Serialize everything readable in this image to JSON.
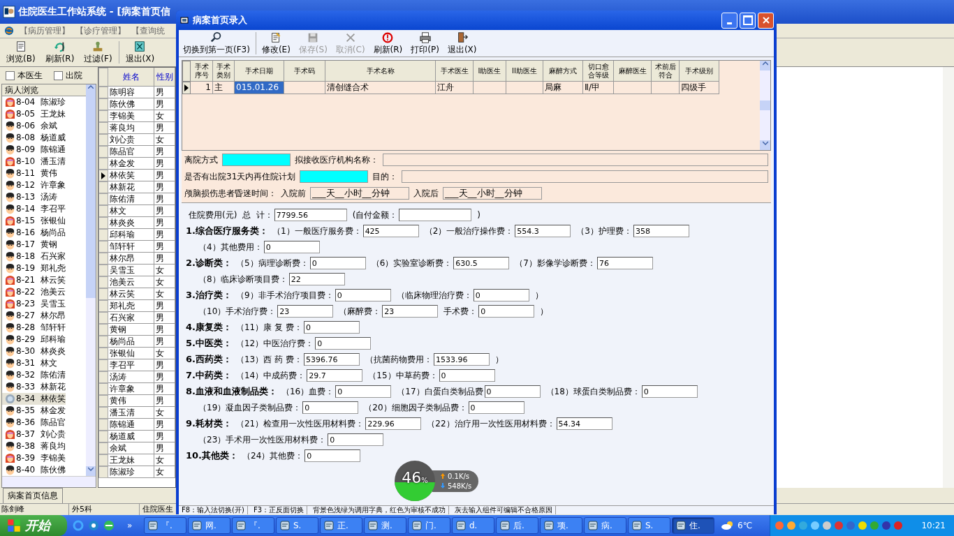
{
  "main_window": {
    "title": "住院医生工作站系统 - [病案首页信",
    "menu": [
      "【病历管理】",
      "【诊疗管理】",
      "【查询统"
    ],
    "toolbar": [
      {
        "label": "浏览(B)"
      },
      {
        "label": "刷新(R)"
      },
      {
        "label": "过滤(F)"
      },
      {
        "label": "退出(X)"
      }
    ],
    "filters": [
      {
        "label": "本医生",
        "checked": false
      },
      {
        "label": "出院",
        "checked": false
      }
    ],
    "patient_list": {
      "header": "病人浏览",
      "items": [
        {
          "bed": "8-04",
          "name": "陈淑珍",
          "female": true,
          "selected": false
        },
        {
          "bed": "8-05",
          "name": "王龙妹",
          "female": true,
          "selected": false
        },
        {
          "bed": "8-06",
          "name": "余斌",
          "female": false,
          "selected": false
        },
        {
          "bed": "8-08",
          "name": "杨道威",
          "female": false,
          "selected": false
        },
        {
          "bed": "8-09",
          "name": "陈锦通",
          "female": false,
          "selected": false
        },
        {
          "bed": "8-10",
          "name": "潘玉清",
          "female": true,
          "selected": false
        },
        {
          "bed": "8-11",
          "name": "黄伟",
          "female": false,
          "selected": false
        },
        {
          "bed": "8-12",
          "name": "许章象",
          "female": false,
          "selected": false
        },
        {
          "bed": "8-13",
          "name": "汤涛",
          "female": false,
          "selected": false
        },
        {
          "bed": "8-14",
          "name": "李召平",
          "female": false,
          "selected": false
        },
        {
          "bed": "8-15",
          "name": "张银仙",
          "female": true,
          "selected": false
        },
        {
          "bed": "8-16",
          "name": "杨尚品",
          "female": false,
          "selected": false
        },
        {
          "bed": "8-17",
          "name": "黄钢",
          "female": false,
          "selected": false
        },
        {
          "bed": "8-18",
          "name": "石兴家",
          "female": false,
          "selected": false
        },
        {
          "bed": "8-19",
          "name": "郑礼尧",
          "female": false,
          "selected": false
        },
        {
          "bed": "8-21",
          "name": "林云笑",
          "female": true,
          "selected": false
        },
        {
          "bed": "8-22",
          "name": "池美云",
          "female": true,
          "selected": false
        },
        {
          "bed": "8-23",
          "name": "吴雪玉",
          "female": true,
          "selected": false
        },
        {
          "bed": "8-27",
          "name": "林尔昂",
          "female": false,
          "selected": false
        },
        {
          "bed": "8-28",
          "name": "邹轩轩",
          "female": false,
          "selected": false
        },
        {
          "bed": "8-29",
          "name": "邱科瑜",
          "female": false,
          "selected": false
        },
        {
          "bed": "8-30",
          "name": "林炎炎",
          "female": false,
          "selected": false
        },
        {
          "bed": "8-31",
          "name": "林文",
          "female": false,
          "selected": false
        },
        {
          "bed": "8-32",
          "name": "陈佑清",
          "female": false,
          "selected": false
        },
        {
          "bed": "8-33",
          "name": "林新花",
          "female": false,
          "selected": false
        },
        {
          "bed": "8-34",
          "name": "林依笑",
          "female": false,
          "selected": true
        },
        {
          "bed": "8-35",
          "name": "林金发",
          "female": false,
          "selected": false
        },
        {
          "bed": "8-36",
          "name": "陈品官",
          "female": false,
          "selected": false
        },
        {
          "bed": "8-37",
          "name": "刘心贵",
          "female": true,
          "selected": false
        },
        {
          "bed": "8-38",
          "name": "蒋良均",
          "female": false,
          "selected": false
        },
        {
          "bed": "8-39",
          "name": "李锦美",
          "female": true,
          "selected": false
        },
        {
          "bed": "8-40",
          "name": "陈伙佛",
          "female": false,
          "selected": false
        }
      ]
    },
    "grid": {
      "columns": [
        "姓名",
        "性别"
      ],
      "rows": [
        {
          "name": "陈明容",
          "sex": "男",
          "current": false
        },
        {
          "name": "陈伙佛",
          "sex": "男",
          "current": false
        },
        {
          "name": "李锦美",
          "sex": "女",
          "current": false
        },
        {
          "name": "蒋良均",
          "sex": "男",
          "current": false
        },
        {
          "name": "刘心贵",
          "sex": "女",
          "current": false
        },
        {
          "name": "陈品官",
          "sex": "男",
          "current": false
        },
        {
          "name": "林金发",
          "sex": "男",
          "current": false
        },
        {
          "name": "林依笑",
          "sex": "男",
          "current": true
        },
        {
          "name": "林新花",
          "sex": "男",
          "current": false
        },
        {
          "name": "陈佑清",
          "sex": "男",
          "current": false
        },
        {
          "name": "林文",
          "sex": "男",
          "current": false
        },
        {
          "name": "林炎炎",
          "sex": "男",
          "current": false
        },
        {
          "name": "邱科瑜",
          "sex": "男",
          "current": false
        },
        {
          "name": "邹轩轩",
          "sex": "男",
          "current": false
        },
        {
          "name": "林尔昂",
          "sex": "男",
          "current": false
        },
        {
          "name": "吴雪玉",
          "sex": "女",
          "current": false
        },
        {
          "name": "池美云",
          "sex": "女",
          "current": false
        },
        {
          "name": "林云笑",
          "sex": "女",
          "current": false
        },
        {
          "name": "郑礼尧",
          "sex": "男",
          "current": false
        },
        {
          "name": "石兴家",
          "sex": "男",
          "current": false
        },
        {
          "name": "黄钢",
          "sex": "男",
          "current": false
        },
        {
          "name": "杨尚品",
          "sex": "男",
          "current": false
        },
        {
          "name": "张银仙",
          "sex": "女",
          "current": false
        },
        {
          "name": "李召平",
          "sex": "男",
          "current": false
        },
        {
          "name": "汤涛",
          "sex": "男",
          "current": false
        },
        {
          "name": "许章象",
          "sex": "男",
          "current": false
        },
        {
          "name": "黄伟",
          "sex": "男",
          "current": false
        },
        {
          "name": "潘玉清",
          "sex": "女",
          "current": false
        },
        {
          "name": "陈锦通",
          "sex": "男",
          "current": false
        },
        {
          "name": "杨道威",
          "sex": "男",
          "current": false
        },
        {
          "name": "余斌",
          "sex": "男",
          "current": false
        },
        {
          "name": "王龙妹",
          "sex": "女",
          "current": false
        },
        {
          "name": "陈淑珍",
          "sex": "女",
          "current": false
        }
      ]
    },
    "tab": "病案首页信息",
    "status_bar": [
      "陈剑峰",
      "外5科",
      "住院医生"
    ]
  },
  "dialog": {
    "title": "病案首页录入",
    "toolbar": [
      {
        "label": "切换到第一页(F3)",
        "disabled": false
      },
      {
        "label": "修改(E)",
        "disabled": false
      },
      {
        "label": "保存(S)",
        "disabled": true
      },
      {
        "label": "取消(C)",
        "disabled": true
      },
      {
        "label": "刷新(R)",
        "disabled": false
      },
      {
        "label": "打印(P)",
        "disabled": false
      },
      {
        "label": "退出(X)",
        "disabled": false
      }
    ],
    "surgery_table": {
      "columns": [
        "手术序号",
        "手术类别",
        "手术日期",
        "手术码",
        "手术名称",
        "手术医生",
        "I助医生",
        "II助医生",
        "麻醉方式",
        "切口愈合等级",
        "麻醉医生",
        "术前后符合",
        "手术级别"
      ],
      "rows": [
        {
          "current": true,
          "cells": [
            {
              "text": "1",
              "selected": false
            },
            {
              "text": "主",
              "selected": false
            },
            {
              "text": "015.01.26",
              "selected": true
            },
            {
              "text": "",
              "selected": false
            },
            {
              "text": "清创缝合术",
              "selected": false
            },
            {
              "text": "江舟",
              "selected": false
            },
            {
              "text": "",
              "selected": false
            },
            {
              "text": "",
              "selected": false
            },
            {
              "text": "局麻",
              "selected": false
            },
            {
              "text": "Ⅱ/甲",
              "selected": false
            },
            {
              "text": "",
              "selected": false
            },
            {
              "text": "",
              "selected": false
            },
            {
              "text": "四级手",
              "selected": false
            }
          ]
        }
      ]
    },
    "discharge": [
      {
        "label": "离院方式",
        "dictionary": true,
        "label2": "拟接收医疗机构名称："
      },
      {
        "label": "是否有出院31天内再住院计划",
        "dictionary": true,
        "label2": "目的："
      }
    ],
    "coma": {
      "label": "颅脑损伤患者昏迷时间：",
      "before_label": "入院前",
      "before_value": "___天__小时__分钟",
      "after_label": "入院后",
      "after_value": "___天__小时__分钟"
    },
    "costs": {
      "total": {
        "label": "住院费用(元)  总  计：",
        "value": "7799.56",
        "self_label": "(自付金额：",
        "close": ")"
      },
      "categories": [
        {
          "title": "1.综合医疗服务类：",
          "lines": [
            [
              {
                "label": "（1）一般医疗服务费：",
                "value": "425"
              },
              {
                "label": "（2）一般治疗操作费：",
                "value": "554.3"
              },
              {
                "label": "（3）护理费：",
                "value": "358"
              }
            ],
            [
              {
                "label": "（4）其他费用：",
                "value": "0"
              }
            ]
          ]
        },
        {
          "title": "2.诊断类：",
          "lines": [
            [
              {
                "label": "（5）病理诊断费：",
                "value": "0"
              },
              {
                "label": "（6）实验室诊断费：",
                "value": "630.5"
              },
              {
                "label": "（7）影像学诊断费：",
                "value": "76"
              }
            ],
            [
              {
                "label": "（8）临床诊断项目费：",
                "value": "22"
              }
            ]
          ]
        },
        {
          "title": "3.治疗类：",
          "lines": [
            [
              {
                "label": "（9）非手术治疗项目费：",
                "value": "0"
              },
              {
                "label": "（临床物理治疗费：",
                "value": "0",
                "after": "）"
              }
            ],
            [
              {
                "label": "（10）手术治疗费：",
                "value": "23"
              },
              {
                "label": "（麻醉费：",
                "value": "23"
              },
              {
                "label": "手术费：",
                "value": "0",
                "after": "）"
              }
            ]
          ]
        },
        {
          "title": "4.康复类：",
          "lines": [
            [
              {
                "label": "（11）康 复 费：",
                "value": "0"
              }
            ]
          ]
        },
        {
          "title": "5.中医类：",
          "lines": [
            [
              {
                "label": "（12）中医治疗费：",
                "value": "0"
              }
            ]
          ]
        },
        {
          "title": "6.西药类：",
          "lines": [
            [
              {
                "label": "（13）西 药 费：",
                "value": "5396.76"
              },
              {
                "label": "（抗菌药物费用：",
                "value": "1533.96",
                "after": "）"
              }
            ]
          ]
        },
        {
          "title": "7.中药类：",
          "lines": [
            [
              {
                "label": "（14）中成药费：",
                "value": "29.7"
              },
              {
                "label": "（15）中草药费：",
                "value": "0"
              }
            ]
          ]
        },
        {
          "title": "8.血液和血液制品类：",
          "lines": [
            [
              {
                "label": "（16）血费：",
                "value": "0"
              },
              {
                "label": "（17）白蛋白类制品费",
                "value": "0"
              },
              {
                "label": "（18）球蛋白类制品费：",
                "value": "0"
              }
            ],
            [
              {
                "label": "（19）凝血因子类制品费：",
                "value": "0"
              },
              {
                "label": "（20）细胞因子类制品费：",
                "value": "0"
              }
            ]
          ]
        },
        {
          "title": "9.耗材类：",
          "lines": [
            [
              {
                "label": "（21）检查用一次性医用材料费：",
                "value": "229.96"
              },
              {
                "label": "（22）治疗用一次性医用材料费：",
                "value": "54.34"
              }
            ],
            [
              {
                "label": "（23）手术用一次性医用材料费：",
                "value": "0"
              }
            ]
          ]
        },
        {
          "title": "10.其他类：",
          "lines": [
            [
              {
                "label": "（24）其他费：",
                "value": "0"
              }
            ]
          ]
        }
      ]
    },
    "status_bar": [
      "F8：输入法切换(开)",
      "F3：正反面切换",
      "背景色浅绿为调用字典，红色为审核不成功",
      "灰去输入组件可编辑不合格原因"
    ]
  },
  "net_widget": {
    "percent": "46",
    "unit": "%",
    "upload": "0.1K/s",
    "download": "548K/s"
  },
  "taskbar": {
    "start": "开始",
    "chevron": "»",
    "tasks": [
      {
        "label": "『.",
        "active": false
      },
      {
        "label": "网.",
        "active": false
      },
      {
        "label": "『.",
        "active": false
      },
      {
        "label": "S.",
        "active": false
      },
      {
        "label": "正.",
        "active": false
      },
      {
        "label": "测.",
        "active": false
      },
      {
        "label": "门.",
        "active": false
      },
      {
        "label": "d.",
        "active": false
      },
      {
        "label": "后.",
        "active": false
      },
      {
        "label": "项.",
        "active": false
      },
      {
        "label": "病.",
        "active": false
      },
      {
        "label": "S.",
        "active": false
      },
      {
        "label": "住.",
        "active": true
      }
    ],
    "weather": "6℃",
    "clock": "10:21"
  }
}
